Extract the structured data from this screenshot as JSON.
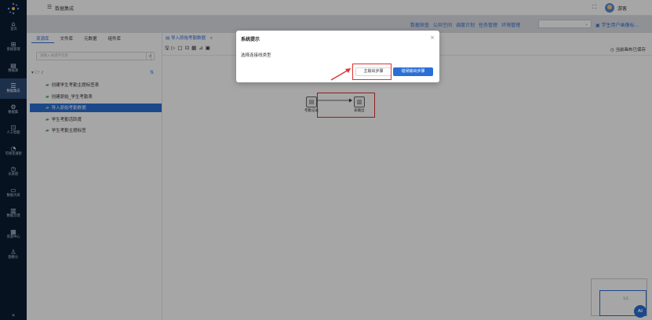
{
  "rail": {
    "items": [
      {
        "icon": "⌂",
        "label": "首页"
      },
      {
        "icon": "⊞",
        "label": "系统管理"
      },
      {
        "icon": "▤",
        "label": "数据源"
      },
      {
        "icon": "☰",
        "label": "数据集成",
        "active": true
      },
      {
        "icon": "⚙",
        "label": "数据集"
      },
      {
        "icon": "⊡",
        "label": "人工智能"
      },
      {
        "icon": "◔",
        "label": "可视化搜索"
      },
      {
        "icon": "◷",
        "label": "仪表盘"
      },
      {
        "icon": "▭",
        "label": "数据大屏"
      },
      {
        "icon": "▥",
        "label": "数据治理"
      },
      {
        "icon": "▦",
        "label": "资源中心"
      },
      {
        "icon": "♙",
        "label": "勘察分"
      }
    ],
    "collapse_icon": "«"
  },
  "topbar": {
    "title": "数据集成",
    "username": "游客"
  },
  "subnav": {
    "links": [
      "数据探查",
      "公共空间",
      "调度计划",
      "任务管理",
      "环境管理"
    ],
    "project": "学生用户画像标..."
  },
  "leftpanel": {
    "tabs": [
      "资源库",
      "文件库",
      "元数据",
      "组件库"
    ],
    "search_placeholder": "请输入关键字检索",
    "root": "/",
    "items": [
      {
        "label": "创建学生考勤主题标签表"
      },
      {
        "label": "创建原始_学生考勤表"
      },
      {
        "label": "导入原始考勤数据",
        "selected": true
      },
      {
        "label": "学生考勤活跃度"
      },
      {
        "label": "学生考勤主题标签"
      }
    ]
  },
  "editor": {
    "tab_label": "导入原始考勤数据",
    "saved_text": "当前画布已保存",
    "node_source_label": "考勤记录",
    "node_target_label": "表输出",
    "minimap_page": "1/1"
  },
  "ai_button": "AI",
  "dialog": {
    "title": "系统提示",
    "message": "选择连接线类型",
    "main_button": "主输出步骤",
    "error_button": "错误输出步骤"
  },
  "colors": {
    "rail_bg": "#0b1c33",
    "accent": "#2a6fd6",
    "highlight": "#e03131"
  }
}
